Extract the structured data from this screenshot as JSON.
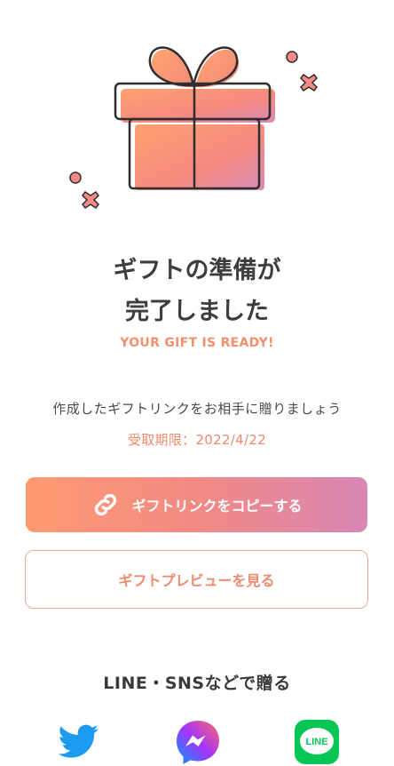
{
  "hero": {
    "title_line1": "ギフトの準備が",
    "title_line2": "完了しました",
    "subtitle": "YOUR GIFT IS READY!"
  },
  "info": {
    "description": "作成したギフトリンクをお相手に贈りましょう",
    "expiry": "受取期限：2022/4/22"
  },
  "buttons": {
    "copy_label": "ギフトリンクをコピーする",
    "copy_icon": "link-icon",
    "preview_label": "ギフトプレビューを見る"
  },
  "share": {
    "heading": "LINE・SNSなどで贈る",
    "services": [
      {
        "name": "twitter",
        "icon": "twitter-icon",
        "color": "#1d9bf0"
      },
      {
        "name": "messenger",
        "icon": "messenger-icon",
        "color": "#a334fa"
      },
      {
        "name": "line",
        "icon": "line-icon",
        "color": "#06c755",
        "icon_text": "LINE"
      }
    ]
  },
  "colors": {
    "accent": "#f0906d",
    "gradient_start": "#ff9a72",
    "gradient_end": "#d886b5",
    "title_text": "#3d3d3d"
  }
}
